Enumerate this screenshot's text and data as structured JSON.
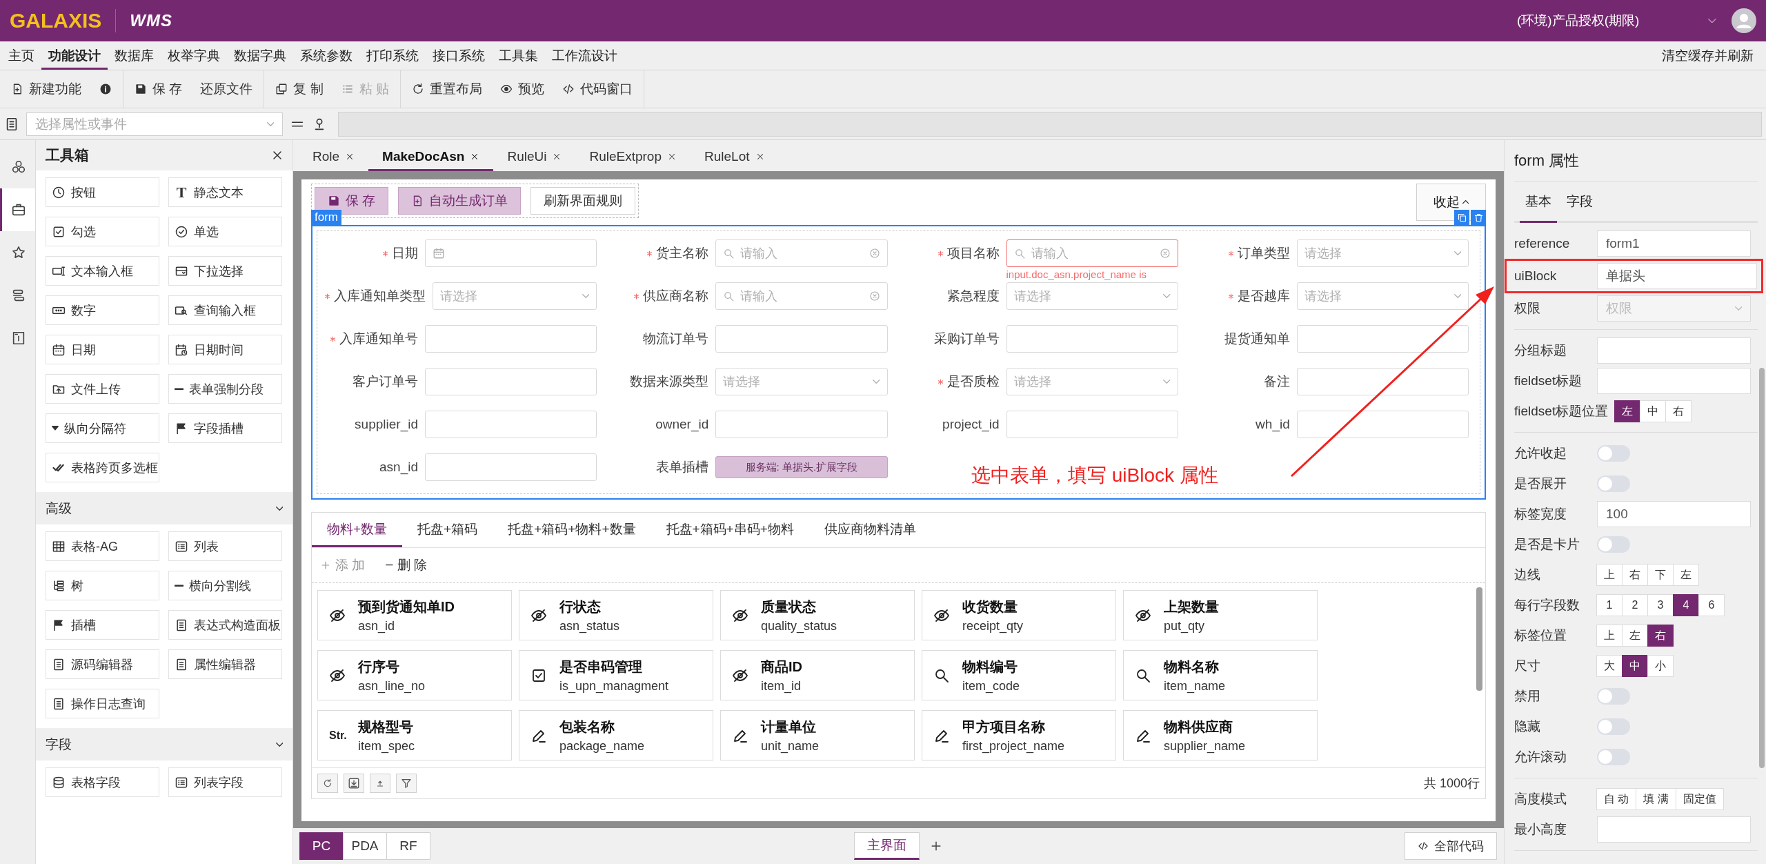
{
  "header": {
    "logo": "GALAXIS",
    "product": "WMS",
    "license": "(环境)产品授权(期限)"
  },
  "menu": {
    "items": [
      {
        "label": "主页",
        "selected": false
      },
      {
        "label": "功能设计",
        "selected": true
      },
      {
        "label": "数据库",
        "selected": false
      },
      {
        "label": "枚举字典",
        "selected": false
      },
      {
        "label": "数据字典",
        "selected": false
      },
      {
        "label": "系统参数",
        "selected": false
      },
      {
        "label": "打印系统",
        "selected": false
      },
      {
        "label": "接口系统",
        "selected": false
      },
      {
        "label": "工具集",
        "selected": false
      },
      {
        "label": "工作流设计",
        "selected": false
      }
    ],
    "action": "清空缓存并刷新"
  },
  "toolbar": [
    [
      {
        "kind": "button",
        "label": "新建功能",
        "disabled": false
      },
      {
        "kind": "icon",
        "disabled": false
      }
    ],
    [
      {
        "kind": "button",
        "label": "保 存",
        "disabled": false
      },
      {
        "kind": "button",
        "label": "还原文件",
        "disabled": false
      }
    ],
    [
      {
        "kind": "button",
        "label": "复 制",
        "disabled": false
      },
      {
        "kind": "button",
        "label": "粘 贴",
        "disabled": true
      }
    ],
    [
      {
        "kind": "button",
        "label": "重置布局",
        "disabled": false
      },
      {
        "kind": "button",
        "label": "预览",
        "disabled": false
      },
      {
        "kind": "button",
        "label": "代码窗口",
        "disabled": false
      }
    ]
  ],
  "selector": {
    "placeholder": "选择属性或事件"
  },
  "rail": [
    {
      "selected": false
    },
    {
      "selected": true
    },
    {
      "selected": false
    },
    {
      "selected": false
    },
    {
      "selected": false
    }
  ],
  "toolbox": {
    "title": "工具箱",
    "groups": [
      {
        "items": [
          {
            "label": "按钮"
          },
          {
            "label": "静态文本",
            "icon_text": "T"
          },
          {
            "label": "勾选"
          },
          {
            "label": "单选"
          },
          {
            "label": "文本输入框"
          },
          {
            "label": "下拉选择"
          },
          {
            "label": "数字"
          },
          {
            "label": "查询输入框"
          },
          {
            "label": "日期"
          },
          {
            "label": "日期时间"
          },
          {
            "label": "文件上传"
          },
          {
            "label": "表单强制分段"
          },
          {
            "label": "纵向分隔符"
          },
          {
            "label": "字段插槽"
          },
          {
            "label": "表格跨页多选框"
          }
        ]
      },
      {
        "title": "高级",
        "expanded": true,
        "items": [
          {
            "label": "表格-AG"
          },
          {
            "label": "列表"
          },
          {
            "label": "树"
          },
          {
            "label": "横向分割线"
          },
          {
            "label": "插槽"
          },
          {
            "label": "表达式构造面板"
          },
          {
            "label": "源码编辑器"
          },
          {
            "label": "属性编辑器"
          },
          {
            "label": "操作日志查询"
          }
        ]
      },
      {
        "title": "字段",
        "expanded": true,
        "items": [
          {
            "label": "表格字段"
          },
          {
            "label": "列表字段"
          }
        ]
      }
    ]
  },
  "tabs": [
    {
      "label": "Role",
      "selected": false
    },
    {
      "label": "MakeDocAsn",
      "selected": true
    },
    {
      "label": "RuleUi",
      "selected": false
    },
    {
      "label": "RuleExtprop",
      "selected": false
    },
    {
      "label": "RuleLot",
      "selected": false
    }
  ],
  "canvas": {
    "buttons": [
      {
        "label": "保 存",
        "kind": "primary"
      },
      {
        "label": "自动生成订单",
        "kind": "primary"
      },
      {
        "label": "刷新界面规则",
        "kind": "default"
      }
    ],
    "collapse": "收起",
    "form": {
      "badge": "form",
      "fields": [
        {
          "label": "日期",
          "required": true,
          "kind": "date"
        },
        {
          "label": "货主名称",
          "required": true,
          "kind": "search",
          "placeholder": "请输入"
        },
        {
          "label": "项目名称",
          "required": true,
          "kind": "search",
          "placeholder": "请输入",
          "error": "input.doc_asn.project_name is"
        },
        {
          "label": "订单类型",
          "required": true,
          "kind": "select",
          "placeholder": "请选择"
        },
        {
          "label": "入库通知单类型",
          "required": true,
          "kind": "select",
          "placeholder": "请选择"
        },
        {
          "label": "供应商名称",
          "required": true,
          "kind": "search",
          "placeholder": "请输入"
        },
        {
          "label": "紧急程度",
          "required": false,
          "kind": "select",
          "placeholder": "请选择"
        },
        {
          "label": "是否越库",
          "required": true,
          "kind": "select",
          "placeholder": "请选择"
        },
        {
          "label": "入库通知单号",
          "required": true,
          "kind": "input"
        },
        {
          "label": "物流订单号",
          "required": false,
          "kind": "input"
        },
        {
          "label": "采购订单号",
          "required": false,
          "kind": "input"
        },
        {
          "label": "提货通知单",
          "required": false,
          "kind": "input"
        },
        {
          "label": "客户订单号",
          "required": false,
          "kind": "input"
        },
        {
          "label": "数据来源类型",
          "required": false,
          "kind": "select",
          "placeholder": "请选择"
        },
        {
          "label": "是否质检",
          "required": true,
          "kind": "select",
          "placeholder": "请选择"
        },
        {
          "label": "备注",
          "required": false,
          "kind": "input"
        },
        {
          "label": "supplier_id",
          "required": false,
          "kind": "input"
        },
        {
          "label": "owner_id",
          "required": false,
          "kind": "input"
        },
        {
          "label": "project_id",
          "required": false,
          "kind": "input"
        },
        {
          "label": "wh_id",
          "required": false,
          "kind": "input"
        },
        {
          "label": "asn_id",
          "required": false,
          "kind": "input"
        },
        {
          "label": "表单插槽",
          "required": false,
          "kind": "slot",
          "text": "服务端: 单据头.扩展字段"
        }
      ]
    },
    "detail": {
      "tabs": [
        {
          "label": "物料+数量",
          "selected": true
        },
        {
          "label": "托盘+箱码",
          "selected": false
        },
        {
          "label": "托盘+箱码+物料+数量",
          "selected": false
        },
        {
          "label": "托盘+箱码+串码+物料",
          "selected": false
        },
        {
          "label": "供应商物料清单",
          "selected": false
        }
      ],
      "actions": [
        {
          "label": "添 加",
          "kind": "add",
          "disabled": true
        },
        {
          "label": "删 除",
          "kind": "delete",
          "disabled": false
        }
      ],
      "cards": [
        {
          "title": "预到货通知单ID",
          "key": "asn_id",
          "kind": "hidden"
        },
        {
          "title": "行状态",
          "key": "asn_status",
          "kind": "hidden"
        },
        {
          "title": "质量状态",
          "key": "quality_status",
          "kind": "hidden"
        },
        {
          "title": "收货数量",
          "key": "receipt_qty",
          "kind": "hidden"
        },
        {
          "title": "上架数量",
          "key": "put_qty",
          "kind": "hidden"
        },
        {
          "title": "行序号",
          "key": "asn_line_no",
          "kind": "hidden"
        },
        {
          "title": "是否串码管理",
          "key": "is_upn_managment",
          "kind": "checkbox"
        },
        {
          "title": "商品ID",
          "key": "item_id",
          "kind": "hidden"
        },
        {
          "title": "物料编号",
          "key": "item_code",
          "kind": "search"
        },
        {
          "title": "物料名称",
          "key": "item_name",
          "kind": "search"
        },
        {
          "title": "规格型号",
          "key": "item_spec",
          "kind": "text",
          "icon_text": "Str."
        },
        {
          "title": "包装名称",
          "key": "package_name",
          "kind": "edit"
        },
        {
          "title": "计量单位",
          "key": "unit_name",
          "kind": "edit"
        },
        {
          "title": "甲方项目名称",
          "key": "first_project_name",
          "kind": "edit"
        },
        {
          "title": "物料供应商",
          "key": "supplier_name",
          "kind": "edit"
        }
      ],
      "total": "共 1000行"
    }
  },
  "devices": [
    {
      "label": "PC",
      "selected": true
    },
    {
      "label": "PDA",
      "selected": false
    },
    {
      "label": "RF",
      "selected": false
    }
  ],
  "pages": [
    {
      "label": "主界面",
      "selected": true
    }
  ],
  "all_code": "全部代码",
  "properties": {
    "title": "form 属性",
    "tabs": [
      {
        "label": "基本",
        "selected": true
      },
      {
        "label": "字段",
        "selected": false
      }
    ],
    "groups": [
      {
        "rows": [
          {
            "label": "reference",
            "kind": "text",
            "value": "form1",
            "highlighted": false
          },
          {
            "label": "uiBlock",
            "kind": "text",
            "value": "单据头",
            "highlighted": true
          },
          {
            "label": "权限",
            "kind": "select",
            "placeholder": "权限",
            "disabled": true,
            "highlighted": false
          }
        ]
      },
      {
        "rows": [
          {
            "label": "分组标题",
            "kind": "text",
            "highlighted": false
          },
          {
            "label": "fieldset标题",
            "kind": "text",
            "highlighted": false
          },
          {
            "label": "fieldset标题位置",
            "kind": "segmented",
            "highlighted": false,
            "options": [
              {
                "label": "左",
                "selected": true
              },
              {
                "label": "中",
                "selected": false
              },
              {
                "label": "右",
                "selected": false
              }
            ]
          }
        ]
      },
      {
        "rows": [
          {
            "label": "允许收起",
            "kind": "switch",
            "on": false,
            "highlighted": false
          },
          {
            "label": "是否展开",
            "kind": "switch",
            "on": false,
            "highlighted": false
          },
          {
            "label": "标签宽度",
            "kind": "text",
            "value": "100",
            "highlighted": false
          },
          {
            "label": "是否是卡片",
            "kind": "switch",
            "on": false,
            "highlighted": false
          },
          {
            "label": "边线",
            "kind": "segmented",
            "highlighted": false,
            "options": [
              {
                "label": "上",
                "selected": false
              },
              {
                "label": "右",
                "selected": false
              },
              {
                "label": "下",
                "selected": false
              },
              {
                "label": "左",
                "selected": false
              }
            ]
          },
          {
            "label": "每行字段数",
            "kind": "segmented",
            "highlighted": false,
            "options": [
              {
                "label": "1",
                "selected": false
              },
              {
                "label": "2",
                "selected": false
              },
              {
                "label": "3",
                "selected": false
              },
              {
                "label": "4",
                "selected": true
              },
              {
                "label": "6",
                "selected": false
              }
            ]
          },
          {
            "label": "标签位置",
            "kind": "segmented",
            "highlighted": false,
            "options": [
              {
                "label": "上",
                "selected": false
              },
              {
                "label": "左",
                "selected": false
              },
              {
                "label": "右",
                "selected": true
              }
            ]
          },
          {
            "label": "尺寸",
            "kind": "segmented",
            "highlighted": false,
            "options": [
              {
                "label": "大",
                "selected": false
              },
              {
                "label": "中",
                "selected": true
              },
              {
                "label": "小",
                "selected": false
              }
            ]
          },
          {
            "label": "禁用",
            "kind": "switch",
            "on": false,
            "highlighted": false
          },
          {
            "label": "隐藏",
            "kind": "switch",
            "on": false,
            "highlighted": false
          },
          {
            "label": "允许滚动",
            "kind": "switch",
            "on": false,
            "highlighted": false
          }
        ]
      },
      {
        "rows": [
          {
            "label": "高度模式",
            "kind": "segmented",
            "highlighted": false,
            "options": [
              {
                "label": "自 动",
                "selected": false
              },
              {
                "label": "填 满",
                "selected": false
              },
              {
                "label": "固定值",
                "selected": false
              }
            ]
          },
          {
            "label": "最小高度",
            "kind": "text",
            "highlighted": false
          }
        ]
      }
    ]
  },
  "annotation": {
    "text": "选中表单，填写 uiBlock 属性"
  }
}
